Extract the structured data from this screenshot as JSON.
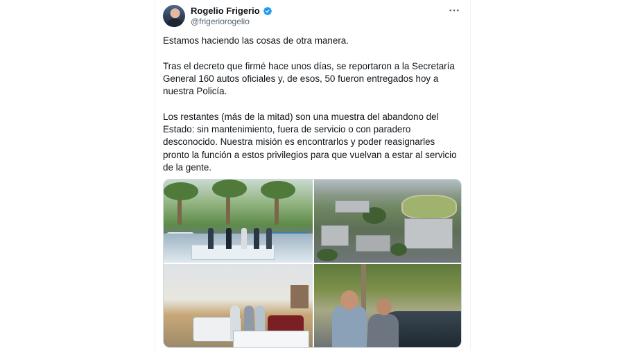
{
  "tweet": {
    "author": {
      "display_name": "Rogelio Frigerio",
      "handle": "@frigeriorogelio",
      "verified": true
    },
    "text": "Estamos haciendo las cosas de otra manera.\n\nTras el decreto que firmé hace unos días, se reportaron a la Secretaría General 160 autos oficiales y, de esos, 50 fueron entregados hoy a nuestra Policía.\n\nLos restantes (más de la mitad) son una muestra del abandono del Estado: sin mantenimiento, fuera de servicio o con paradero desconocido. Nuestra misión es encontrarlos y poder reasignarles pronto la función a estos privilegios para que vuelvan a estar al servicio de la gente.",
    "media_count": 4
  },
  "icons": {
    "verified": "verified-badge-icon",
    "more": "more-options-icon"
  },
  "colors": {
    "verified_blue": "#1d9bf0",
    "text_primary": "#0f1419",
    "text_secondary": "#536471",
    "border": "#cfd9de"
  }
}
